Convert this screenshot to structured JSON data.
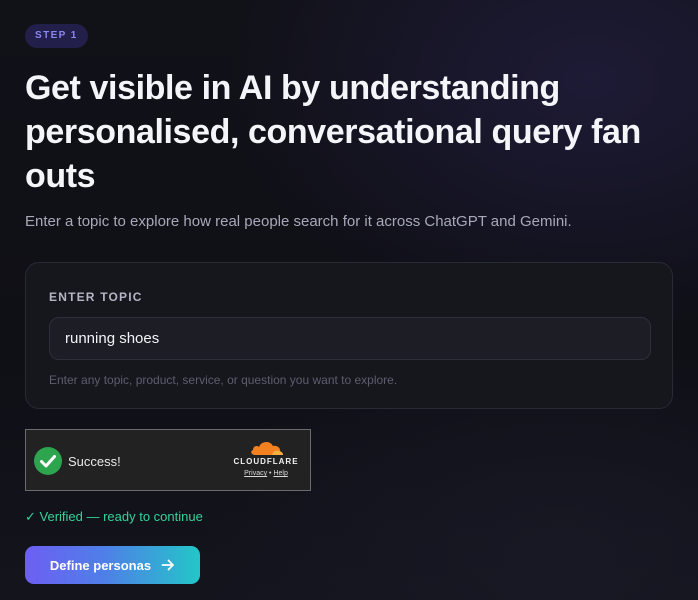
{
  "header": {
    "step_badge": "STEP 1",
    "title": "Get visible in AI by understanding personalised, conversational query fan outs",
    "subtitle": "Enter a topic to explore how real people search for it across ChatGPT and Gemini."
  },
  "topic_card": {
    "label": "ENTER TOPIC",
    "input_value": "running shoes",
    "hint": "Enter any topic, product, service, or question you want to explore."
  },
  "captcha": {
    "status_text": "Success!",
    "brand": "CLOUDFLARE",
    "privacy_link": "Privacy",
    "separator": "•",
    "help_link": "Help",
    "icon": "check-circle-icon"
  },
  "verification": {
    "message": "✓ Verified — ready to continue"
  },
  "actions": {
    "primary_label": "Define personas",
    "primary_icon": "arrow-right-icon"
  },
  "colors": {
    "accent_purple": "#8a86f2",
    "success_green": "#34d399",
    "cloudflare_orange": "#f48120"
  }
}
